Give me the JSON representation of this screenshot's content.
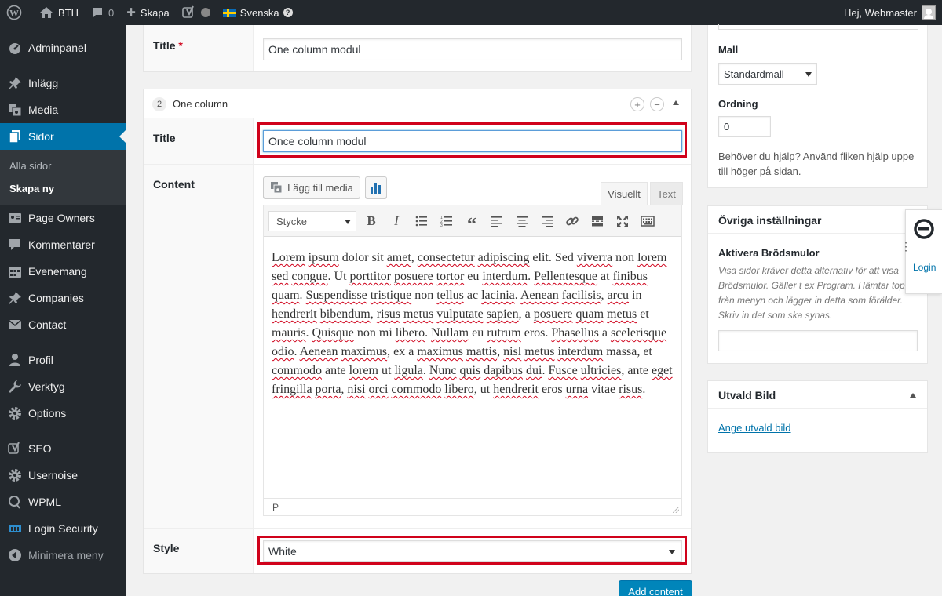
{
  "adminbar": {
    "site_name": "BTH",
    "comments_count": "0",
    "new_label": "Skapa",
    "language": "Svenska",
    "greeting": "Hej, Webmaster"
  },
  "sidebar": {
    "items": [
      {
        "label": "Adminpanel",
        "icon": "dashboard-icon"
      },
      {
        "label": "Inlägg",
        "icon": "pin-icon"
      },
      {
        "label": "Media",
        "icon": "media-icon"
      },
      {
        "label": "Sidor",
        "icon": "pages-icon"
      },
      {
        "label": "Page Owners",
        "icon": "page-owners-icon"
      },
      {
        "label": "Kommentarer",
        "icon": "comment-icon"
      },
      {
        "label": "Evenemang",
        "icon": "calendar-icon"
      },
      {
        "label": "Companies",
        "icon": "pin-icon"
      },
      {
        "label": "Contact",
        "icon": "mail-icon"
      },
      {
        "label": "Profil",
        "icon": "user-icon"
      },
      {
        "label": "Verktyg",
        "icon": "wrench-icon"
      },
      {
        "label": "Options",
        "icon": "gear-icon"
      },
      {
        "label": "SEO",
        "icon": "yoast-icon"
      },
      {
        "label": "Usernoise",
        "icon": "gear-icon"
      },
      {
        "label": "WPML",
        "icon": "wpml-icon"
      },
      {
        "label": "Login Security",
        "icon": "shield-icon"
      },
      {
        "label": "Minimera meny",
        "icon": "collapse-icon"
      }
    ],
    "submenu": [
      "Alla sidor",
      "Skapa ny"
    ]
  },
  "module1": {
    "title_label": "Title",
    "required_mark": "*",
    "title_value": "One column modul"
  },
  "module2": {
    "number": "2",
    "name": "One column",
    "title_label": "Title",
    "title_value": "Once column modul",
    "content_label": "Content",
    "add_media_label": "Lägg till media",
    "tab_visual": "Visuellt",
    "tab_text": "Text",
    "format_select": "Stycke",
    "content_text": "Lorem ipsum dolor sit amet, consectetur adipiscing elit. Sed viverra non lorem sed congue. Ut porttitor posuere tortor eu interdum. Pellentesque at finibus quam. Suspendisse tristique non tellus ac lacinia. Aenean facilisis, arcu in hendrerit bibendum, risus metus vulputate sapien, a posuere quam metus et mauris. Quisque non mi libero. Nullam eu rutrum eros. Phasellus a scelerisque odio. Aenean maximus, ex a maximus mattis, nisl metus interdum massa, et commodo ante lorem ut ligula. Nunc quis dapibus dui. Fusce ultricies, ante eget fringilla porta, nisi orci commodo libero, ut hendrerit eros urna vitae risus.",
    "status_path": "P",
    "style_label": "Style",
    "style_value": "White"
  },
  "add_content_label": "Add content",
  "attributes": {
    "template_label": "Mall",
    "template_value": "Standardmall",
    "order_label": "Ordning",
    "order_value": "0",
    "help_text": "Behöver du hjälp? Använd fliken hjälp uppe till höger på sidan."
  },
  "other_settings": {
    "title": "Övriga inställningar",
    "breadcrumbs_label": "Aktivera Brödsmulor",
    "breadcrumbs_desc": "Visa sidor kräver detta alternativ för att visa Brödsmulor. Gäller t ex Program. Hämtar topnivå från menyn och lägger in detta som förälder. Skriv in det som ska synas.",
    "breadcrumbs_value": ""
  },
  "featured_image": {
    "title": "Utvald Bild",
    "link": "Ange utvald bild"
  },
  "login_widget": {
    "label": "Login"
  }
}
